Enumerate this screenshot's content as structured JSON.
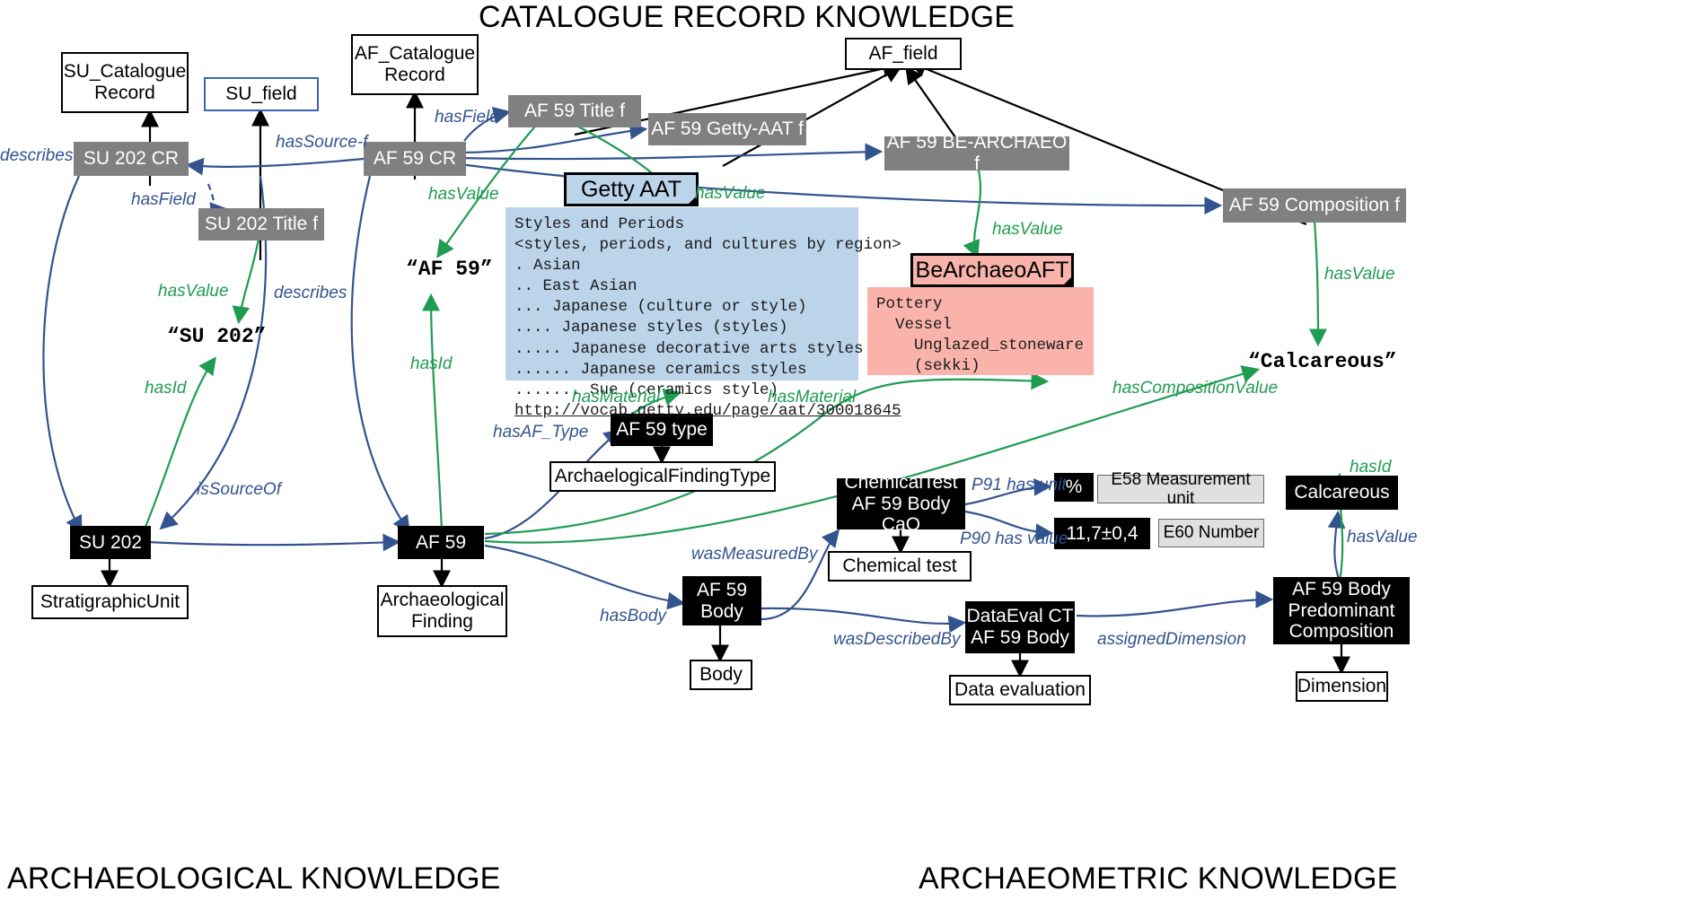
{
  "titles": {
    "top": "CATALOGUE RECORD KNOWLEDGE",
    "bottom_left": "ARCHAEOLOGICAL KNOWLEDGE",
    "bottom_right": "ARCHAEOMETRIC KNOWLEDGE"
  },
  "colors": {
    "grey_node": "#808080",
    "black_node": "#000000",
    "class_box": "#ffffff",
    "blue_note": "#bcd4ea",
    "pink_note": "#f9b3ab",
    "blue_edge": "#33538f",
    "green_edge": "#1f9c52",
    "light_grey_box": "#e0e0e0"
  },
  "nodes": {
    "su_catalogue_record": "SU_Catalogue\nRecord",
    "su_field": "SU_field",
    "af_catalogue_record": "AF_Catalogue\nRecord",
    "af_field": "AF_field",
    "su202_cr": "SU 202 CR",
    "su202_title_f": "SU 202 Title f",
    "af59_cr": "AF 59  CR",
    "af59_title_f": "AF 59 Title f",
    "af59_getty_aat_f": "AF 59 Getty-AAT f",
    "af59_bearchaeo_f": "AF 59 BE-ARCHAEO f",
    "af59_composition_f": "AF 59 Composition f",
    "su202": "SU 202",
    "stratigraphic_unit": "StratigraphicUnit",
    "af59": "AF 59",
    "archaeological_finding": "Archaeological\nFinding",
    "af59_type": "AF 59 type",
    "archaelogical_finding_type": "ArchaelogicalFindingType",
    "chemical_test_instance": "ChemicalTest\nAF 59 Body CaO",
    "chemical_test_class": "Chemical test",
    "percent_unit": "%",
    "e58_measurement_unit": "E58 Measurement unit",
    "value_number": "11,7±0,4",
    "e60_number": "E60 Number",
    "af59_body": "AF 59\nBody",
    "body_class": "Body",
    "dataeval_ct": "DataEval CT\nAF 59 Body",
    "data_evaluation": "Data evaluation",
    "af59_body_predominant_composition": "AF 59 Body\nPredominant\nComposition",
    "dimension": "Dimension",
    "calcareous_node": "Calcareous"
  },
  "literals": {
    "su202": "“SU 202”",
    "af59": "“AF 59”",
    "calcareous": "“Calcareous”"
  },
  "notes": {
    "getty": {
      "header": "Getty AAT",
      "body_lines": [
        "Styles and Periods",
        "<styles, periods, and cultures by region>",
        ". Asian",
        ".. East Asian",
        "... Japanese (culture or style)",
        ".... Japanese styles (styles)",
        "..... Japanese decorative arts styles",
        "...... Japanese ceramics styles",
        "....... Sue (ceramics style)"
      ],
      "url": "http://vocab.getty.edu/page/aat/300018645"
    },
    "bearchaeo": {
      "header": "BeArchaeoAFT",
      "body_lines": [
        "Pottery",
        "  Vessel",
        "    Unglazed_stoneware",
        "    (sekki)"
      ]
    }
  },
  "edge_labels": {
    "describes_left": "describes",
    "has_source_f": "hasSource-f",
    "has_field_su": "hasField",
    "has_field_af": "hasField",
    "has_value_su_title": "hasValue",
    "describes_su_title": "describes",
    "has_id_su": "hasId",
    "is_source_of": "isSourceOf",
    "has_value_af_title": "hasValue",
    "has_id_af": "hasId",
    "has_value_getty": "hasValue",
    "has_value_bearchaeo": "hasValue",
    "has_value_composition": "hasValue",
    "has_material_left": "hasMaterial",
    "has_material_right": "hasMaterial",
    "has_composition_value": "hasCompositionValue",
    "has_af_type": "hasAF_Type",
    "was_measured_by": "wasMeasuredBy",
    "has_body": "hasBody",
    "was_described_by": "wasDescribedBy",
    "assigned_dimension": "assignedDimension",
    "p91_has_unit": "P91 has unit",
    "p90_has_value": "P90 has value",
    "has_id_calcareous": "hasId",
    "has_value_calcareous": "hasValue"
  }
}
